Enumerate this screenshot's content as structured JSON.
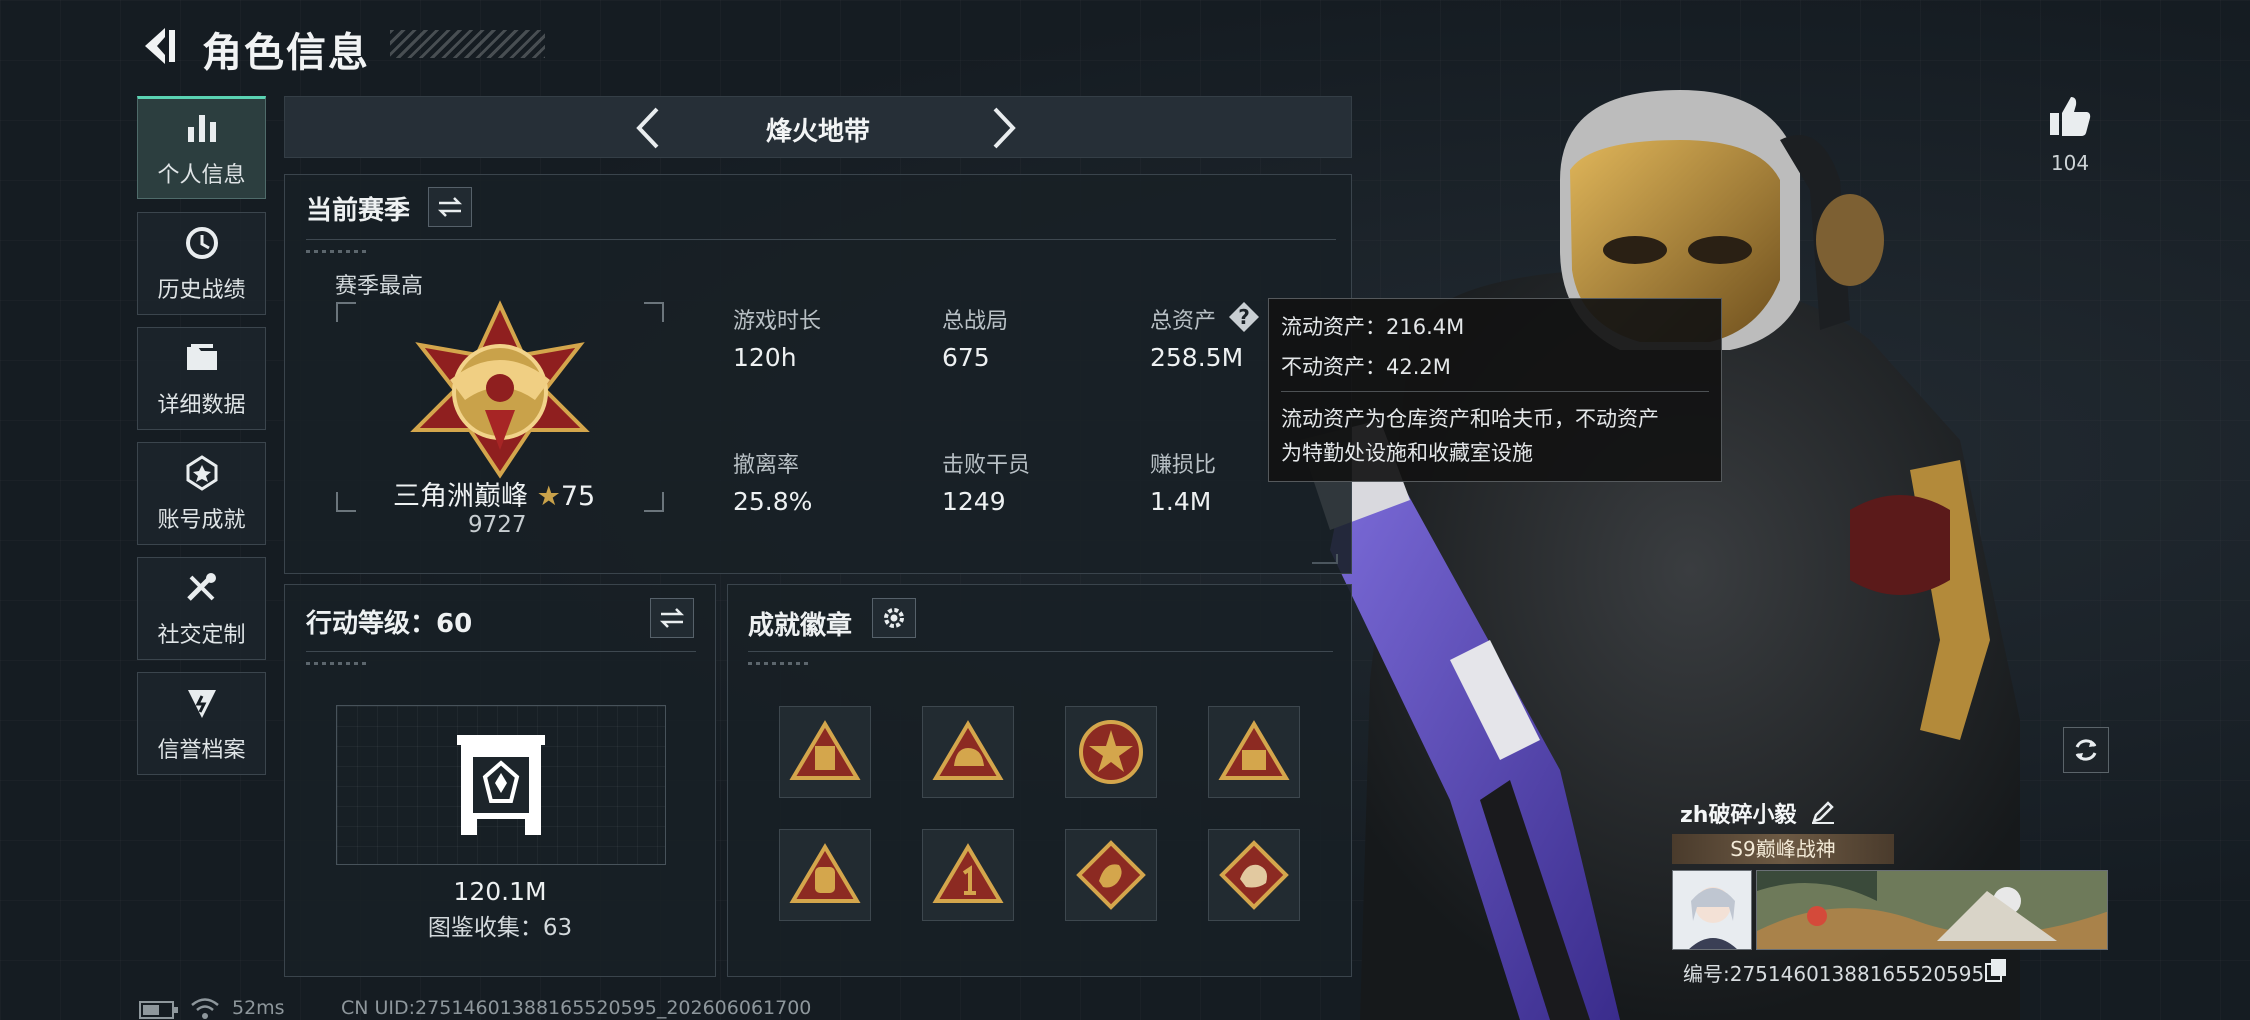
{
  "header": {
    "title": "角色信息"
  },
  "sidebar": {
    "items": [
      {
        "label": "个人信息",
        "icon": "bar-chart-icon"
      },
      {
        "label": "历史战绩",
        "icon": "history-icon"
      },
      {
        "label": "详细数据",
        "icon": "folder-icon"
      },
      {
        "label": "账号成就",
        "icon": "achievement-icon"
      },
      {
        "label": "社交定制",
        "icon": "tools-icon"
      },
      {
        "label": "信誉档案",
        "icon": "shield-icon"
      }
    ]
  },
  "map_selector": {
    "name": "烽火地带"
  },
  "season": {
    "title": "当前赛季",
    "best_label": "赛季最高",
    "rank_name": "三角洲巅峰",
    "rank_stars": "75",
    "rank_score": "9727",
    "stats": [
      {
        "label": "游戏时长",
        "value": "120h"
      },
      {
        "label": "总战局",
        "value": "675"
      },
      {
        "label": "总资产",
        "value": "258.5M"
      },
      {
        "label": "撤离率",
        "value": "25.8%"
      },
      {
        "label": "击败干员",
        "value": "1249"
      },
      {
        "label": "赚损比",
        "value": "1.4M"
      }
    ]
  },
  "tooltip": {
    "liquid": "流动资产：216.4M",
    "fixed": "不动资产：42.2M",
    "desc_line1": "流动资产为仓库资产和哈夫币，不动资产",
    "desc_line2": "为特勤处设施和收藏室设施"
  },
  "action_level": {
    "title": "行动等级：60",
    "value": "120.1M",
    "collection": "图鉴收集：63"
  },
  "badges": {
    "title": "成就徽章",
    "items": [
      {
        "icon": "vest-badge-icon"
      },
      {
        "icon": "helmet-badge-icon"
      },
      {
        "icon": "star-emblem-badge-icon"
      },
      {
        "icon": "crate-badge-icon"
      },
      {
        "icon": "backpack-badge-icon"
      },
      {
        "icon": "number-one-badge-icon"
      },
      {
        "icon": "dragon-badge-icon"
      },
      {
        "icon": "beast-badge-icon"
      }
    ]
  },
  "profile": {
    "likes": "104",
    "name": "zh破碎小毅",
    "title": "S9巅峰战神",
    "id": "编号:27514601388165520595"
  },
  "footer": {
    "ping": "52ms",
    "uid": "CN UID:27514601388165520595_202606061700"
  },
  "colors": {
    "accent": "#5ad3b3",
    "gold": "#c9a24a",
    "background": "#151c22"
  }
}
